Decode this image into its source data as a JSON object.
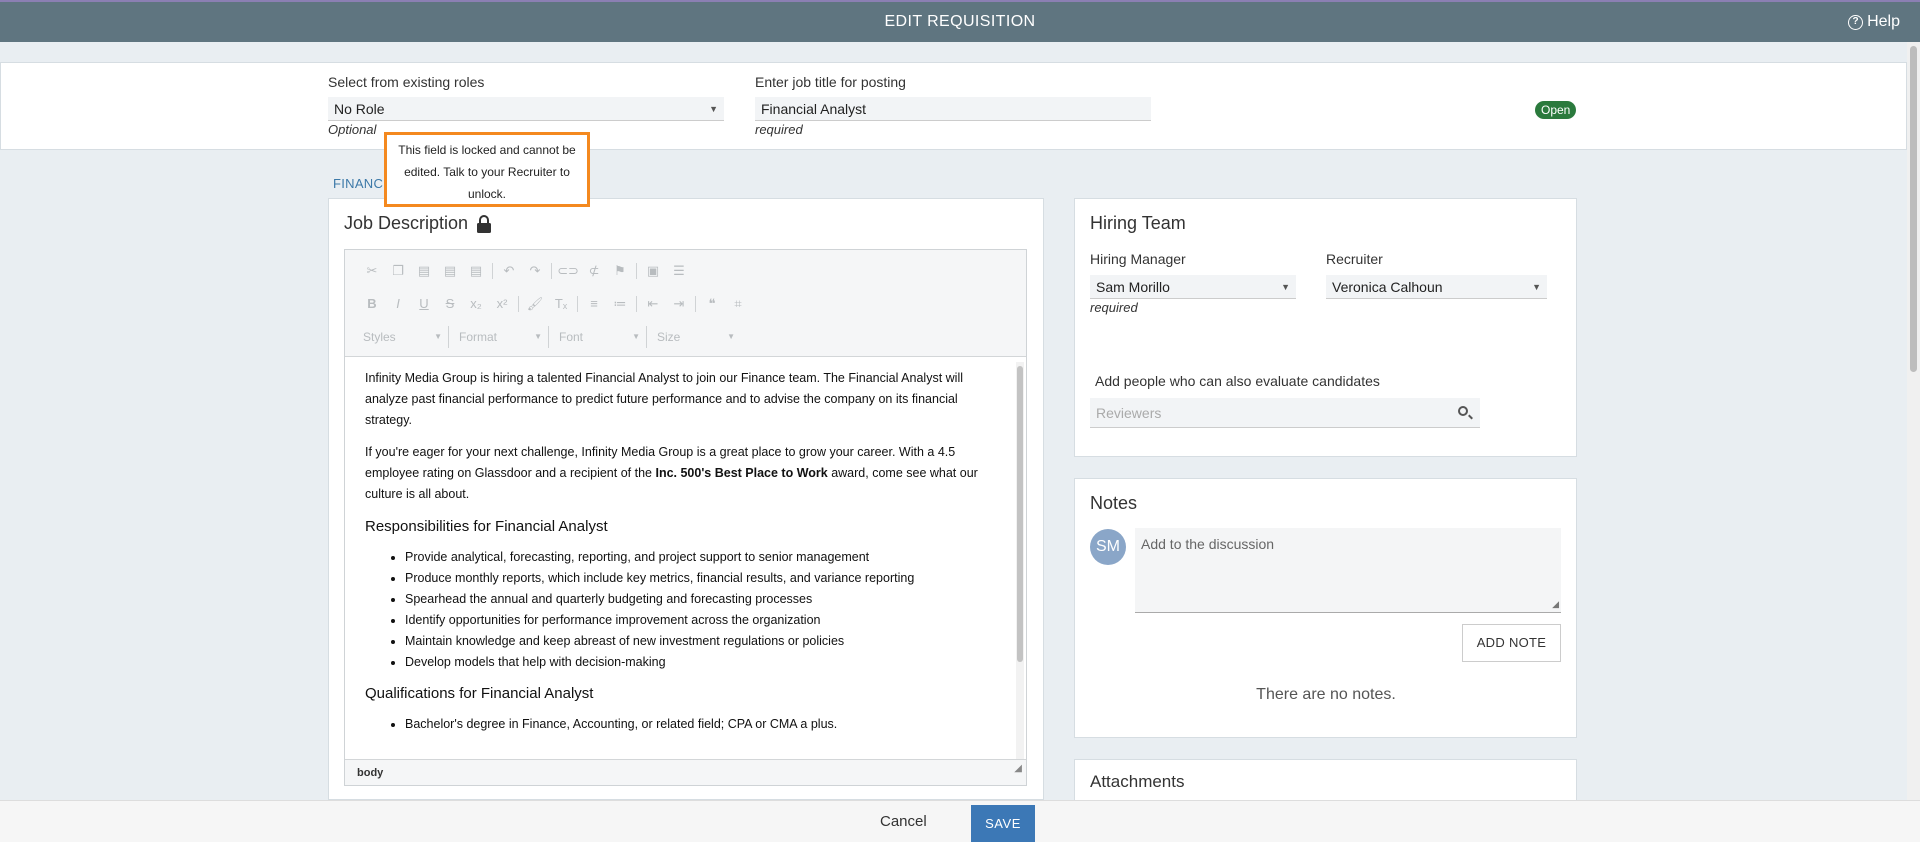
{
  "header": {
    "title": "EDIT REQUISITION",
    "help_label": "Help"
  },
  "role": {
    "label": "Select from existing roles",
    "value": "No Role",
    "hint": "Optional"
  },
  "job_title": {
    "label": "Enter job title for posting",
    "value": "Financial Analyst",
    "hint": "required"
  },
  "status_badge": "Open",
  "tab_label": "FINANC",
  "tooltip": {
    "line1": "This field is locked and cannot be",
    "line2": "edited. Talk to your Recruiter to",
    "line3": "unlock."
  },
  "job_description": {
    "title": "Job Description",
    "toolbar": {
      "styles": "Styles",
      "format": "Format",
      "font": "Font",
      "size": "Size"
    },
    "paragraph1": "Infinity Media Group is hiring a talented Financial Analyst to join our Finance team. The Financial Analyst will analyze past financial performance to predict future performance and to advise the company on its financial strategy.",
    "paragraph2_before": "If you're eager for your next challenge, Infinity Media Group is a great place to grow your career. With a 4.5 employee rating on Glassdoor and a recipient of the ",
    "paragraph2_bold": "Inc. 500's Best Place to Work",
    "paragraph2_after": " award, come see what our culture is all about.",
    "responsibilities_heading": "Responsibilities for Financial Analyst",
    "responsibilities": [
      "Provide analytical, forecasting, reporting, and project support to senior management",
      "Produce monthly reports, which include key metrics, financial results, and variance reporting",
      "Spearhead the annual and quarterly budgeting and forecasting processes",
      "Identify opportunities for performance improvement across the organization",
      "Maintain knowledge and keep abreast of new investment regulations or policies",
      "Develop models that help with decision-making"
    ],
    "qualifications_heading": "Qualifications for Financial Analyst",
    "qualifications": [
      "Bachelor's degree in Finance, Accounting, or related field; CPA or CMA a plus."
    ],
    "status_path": "body"
  },
  "hiring_team": {
    "title": "Hiring Team",
    "manager_label": "Hiring Manager",
    "manager_value": "Sam Morillo",
    "manager_hint": "required",
    "recruiter_label": "Recruiter",
    "recruiter_value": "Veronica Calhoun",
    "reviewers_label": "Add people who can also evaluate candidates",
    "reviewers_placeholder": "Reviewers"
  },
  "notes": {
    "title": "Notes",
    "avatar_initials": "SM",
    "placeholder": "Add to the discussion",
    "add_button": "ADD NOTE",
    "empty_text": "There are no notes."
  },
  "attachments": {
    "title": "Attachments"
  },
  "footer": {
    "cancel_label": "Cancel",
    "save_label": "SAVE"
  },
  "colors": {
    "header_bg": "#5f7580",
    "accent": "#3c78b6",
    "badge_green": "#2b7a3d",
    "tooltip_border": "#f4891f"
  }
}
